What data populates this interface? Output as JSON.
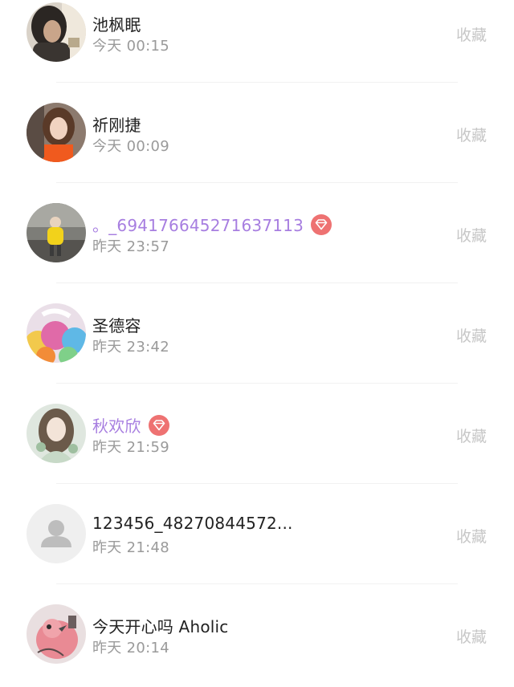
{
  "follower_list": {
    "collect_label": "收藏",
    "items": [
      {
        "name": "池枫眠",
        "time": "今天 00:15",
        "vip": false,
        "avatar": "photo-dark-hair-person-avatar"
      },
      {
        "name": "祈刚捷",
        "time": "今天 00:09",
        "vip": false,
        "avatar": "photo-girl-orange-top-avatar"
      },
      {
        "name": "。_694176645271637113",
        "time": "昨天 23:57",
        "vip": true,
        "avatar": "photo-child-yellow-coat-avatar"
      },
      {
        "name": "圣德容",
        "time": "昨天 23:42",
        "vip": false,
        "avatar": "photo-colorful-lollipops-avatar"
      },
      {
        "name": "秋欢欣",
        "time": "昨天 21:59",
        "vip": true,
        "avatar": "illustration-anime-girl-avatar"
      },
      {
        "name": "123456_48270844572...",
        "time": "昨天 21:48",
        "vip": false,
        "avatar": "default-user-placeholder-avatar"
      },
      {
        "name": "今天开心吗 Aholic",
        "time": "昨天 20:14",
        "vip": false,
        "avatar": "illustration-pink-bird-avatar"
      }
    ]
  },
  "colors": {
    "vip_name": "#a77ee0",
    "vip_badge": "#ee7272",
    "collect_text": "#c7c7c7",
    "time_text": "#9a9a9a"
  }
}
